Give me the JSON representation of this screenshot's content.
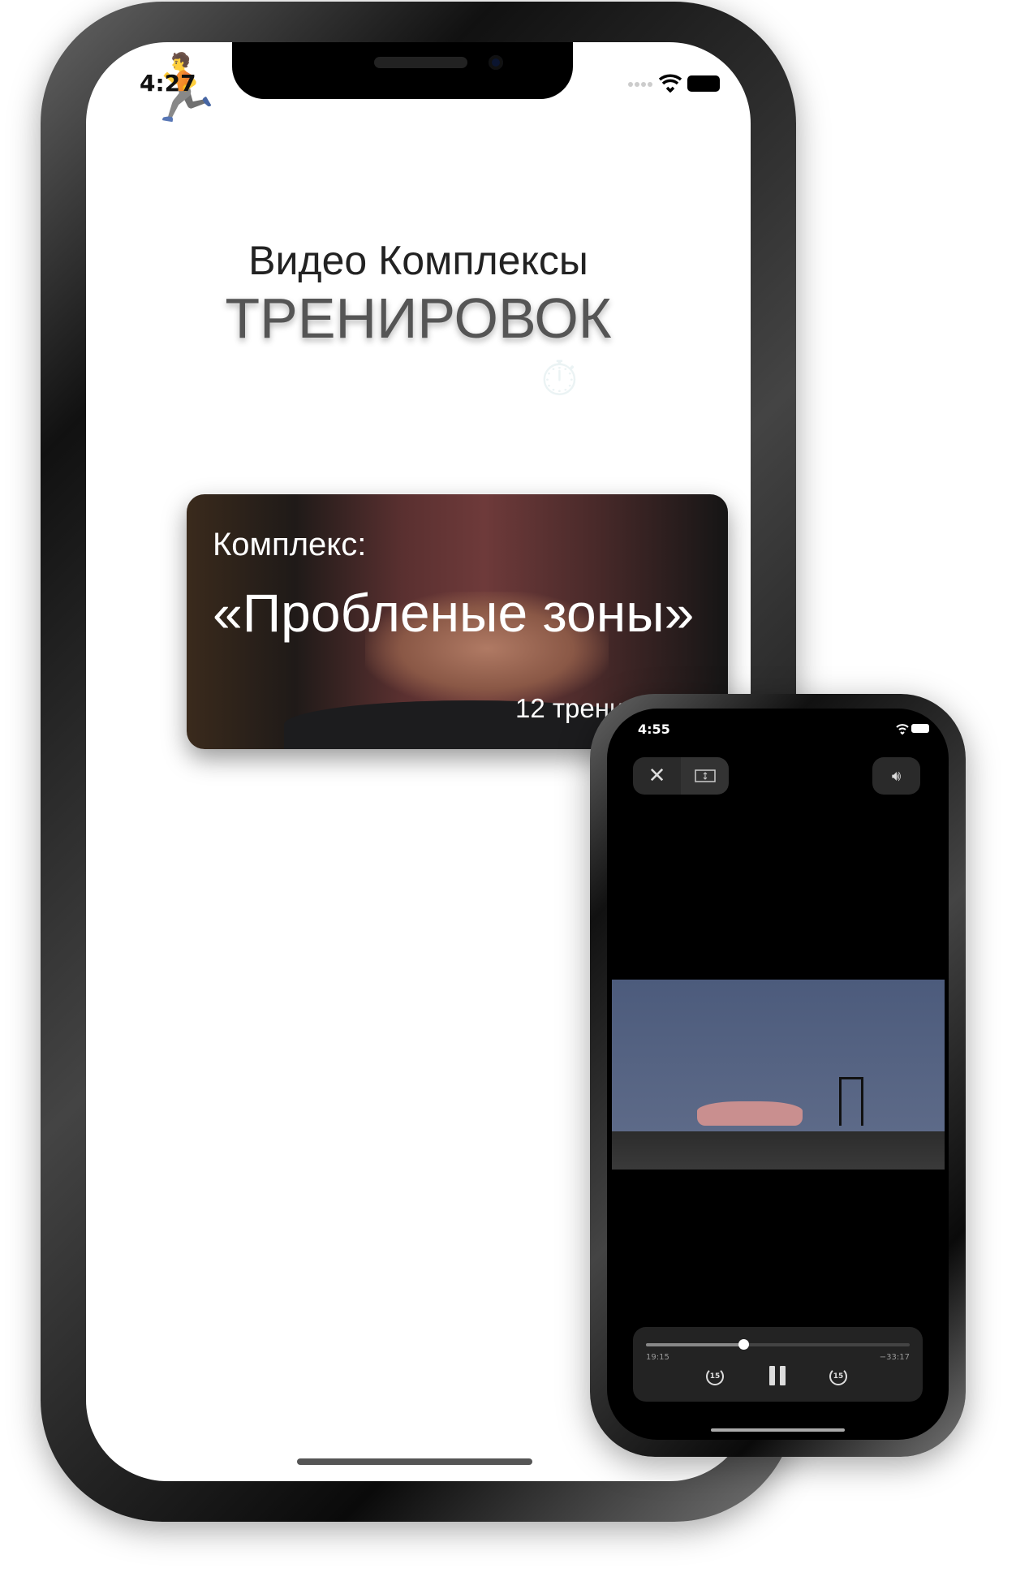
{
  "main_phone": {
    "status_time": "4:27",
    "title_line1": "Видео Комплексы",
    "title_line2": "ТРЕНИРОВОК",
    "card": {
      "label": "Комплекс:",
      "name": "«Пробленые зоны»",
      "count": "12 тренировок"
    }
  },
  "player_phone": {
    "status_time": "4:55",
    "elapsed": "19:15",
    "remaining": "−33:17",
    "progress_fraction": 0.37,
    "skip_back": "15",
    "skip_forward": "15"
  }
}
